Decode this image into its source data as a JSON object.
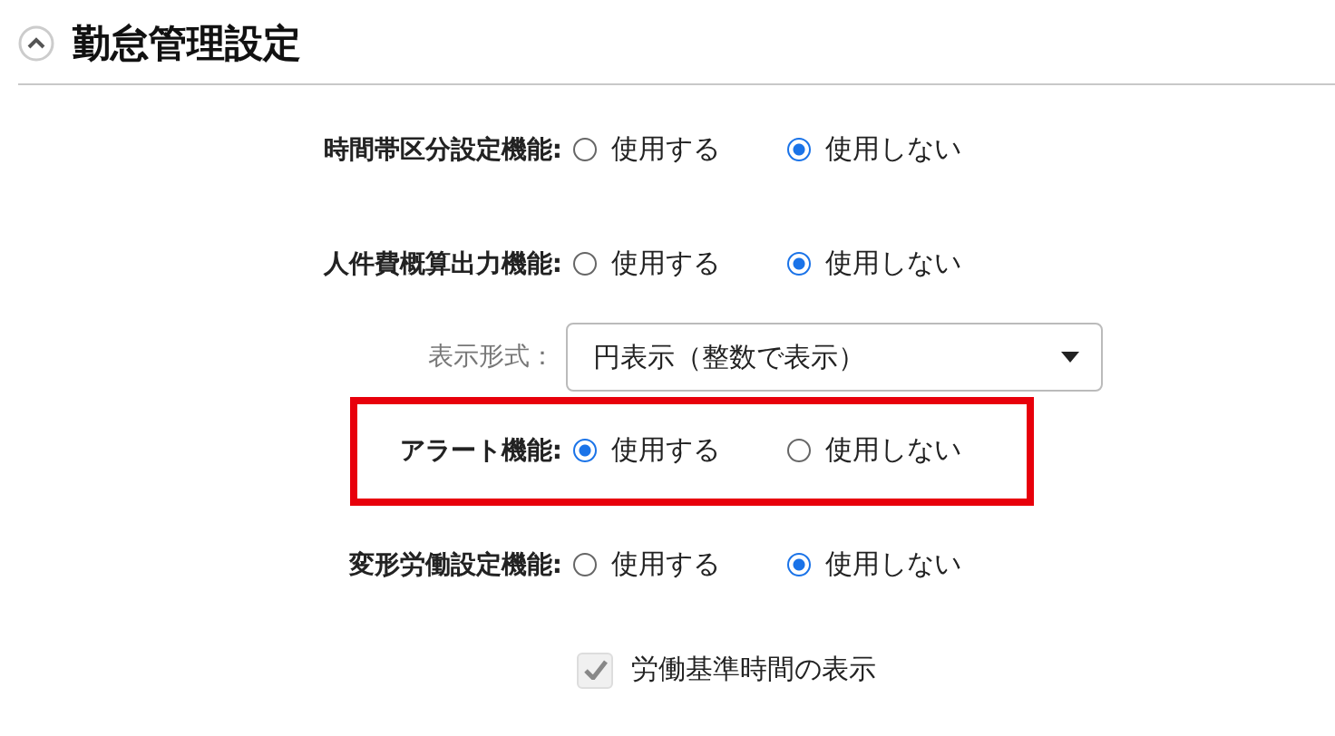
{
  "section": {
    "title": "勤怠管理設定",
    "expanded": true
  },
  "rows": [
    {
      "kind": "radio",
      "label": "時間帯区分設定機能:",
      "highlighted": false,
      "options": [
        {
          "label": "使用する",
          "selected": false
        },
        {
          "label": "使用しない",
          "selected": true
        }
      ]
    },
    {
      "kind": "radio",
      "label": "人件費概算出力機能:",
      "highlighted": false,
      "options": [
        {
          "label": "使用する",
          "selected": false
        },
        {
          "label": "使用しない",
          "selected": true
        }
      ]
    },
    {
      "kind": "select",
      "label": "表示形式：",
      "value": "円表示（整数で表示）"
    },
    {
      "kind": "radio",
      "label": "アラート機能:",
      "highlighted": true,
      "options": [
        {
          "label": "使用する",
          "selected": true
        },
        {
          "label": "使用しない",
          "selected": false
        }
      ]
    },
    {
      "kind": "radio",
      "label": "変形労働設定機能:",
      "highlighted": false,
      "options": [
        {
          "label": "使用する",
          "selected": false
        },
        {
          "label": "使用しない",
          "selected": true
        }
      ]
    },
    {
      "kind": "checkbox",
      "label": "労働基準時間の表示",
      "checked": true,
      "disabled": true
    }
  ]
}
